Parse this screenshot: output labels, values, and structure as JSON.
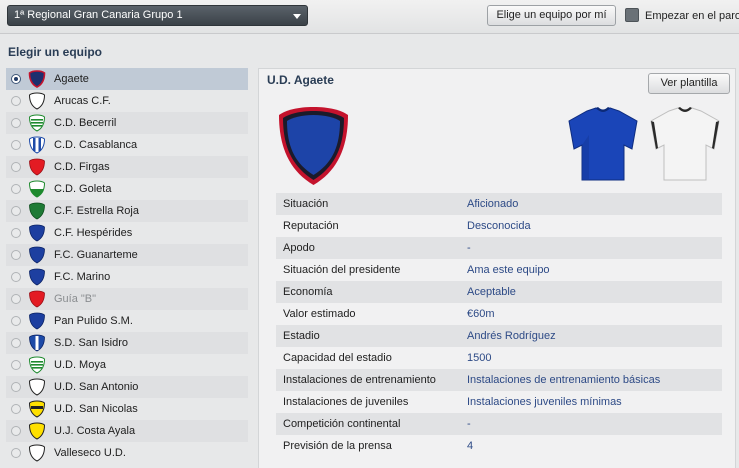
{
  "topbar": {
    "league_select": "1ª Regional Gran Canaria Grupo 1",
    "pick_button": "Elige un equipo por mí",
    "unemployed_label": "Empezar en el paro"
  },
  "left": {
    "title": "Elegir un equipo",
    "teams": [
      {
        "name": "Agaete",
        "crest": "shield-blue-red"
      },
      {
        "name": "Arucas C.F.",
        "crest": "shield-white"
      },
      {
        "name": "C.D. Becerril",
        "crest": "shield-green-stripes"
      },
      {
        "name": "C.D. Casablanca",
        "crest": "shield-blue-white-stripes"
      },
      {
        "name": "C.D. Firgas",
        "crest": "shield-red"
      },
      {
        "name": "C.D. Goleta",
        "crest": "shield-green-white"
      },
      {
        "name": "C.F. Estrella Roja",
        "crest": "shield-green"
      },
      {
        "name": "C.F. Hespérides",
        "crest": "shield-blue"
      },
      {
        "name": "F.C. Guanarteme",
        "crest": "shield-blue"
      },
      {
        "name": "F.C. Marino",
        "crest": "shield-blue"
      },
      {
        "name": "Guía \"B\"",
        "crest": "shield-red"
      },
      {
        "name": "Pan Pulido S.M.",
        "crest": "shield-blue"
      },
      {
        "name": "S.D. San Isidro",
        "crest": "shield-blue-white"
      },
      {
        "name": "U.D. Moya",
        "crest": "shield-green-stripes"
      },
      {
        "name": "U.D. San Antonio",
        "crest": "shield-white"
      },
      {
        "name": "U.D. San Nicolas",
        "crest": "shield-yellow-black"
      },
      {
        "name": "U.J. Costa Ayala",
        "crest": "shield-yellow"
      },
      {
        "name": "Valleseco U.D.",
        "crest": "shield-white"
      }
    ]
  },
  "right": {
    "club_name": "U.D. Agaete",
    "squad_button": "Ver plantilla",
    "details": [
      {
        "label": "Situación",
        "value": "Aficionado"
      },
      {
        "label": "Reputación",
        "value": "Desconocida"
      },
      {
        "label": "Apodo",
        "value": "-"
      },
      {
        "label": "Situación del presidente",
        "value": "Ama este equipo"
      },
      {
        "label": "Economía",
        "value": "Aceptable"
      },
      {
        "label": "Valor estimado",
        "value": "€60m"
      },
      {
        "label": "Estadio",
        "value": "Andrés Rodríguez"
      },
      {
        "label": "Capacidad del estadio",
        "value": "1500"
      },
      {
        "label": "Instalaciones de entrenamiento",
        "value": "Instalaciones de entrenamiento básicas"
      },
      {
        "label": "Instalaciones de juveniles",
        "value": "Instalaciones juveniles mínimas"
      },
      {
        "label": "Competición continental",
        "value": "-"
      },
      {
        "label": "Previsión de la prensa",
        "value": "4"
      }
    ]
  },
  "colors": {
    "accent_dark": "#2a3d55",
    "value_blue": "#2d4a86",
    "selected_row": "#c0cad6",
    "home_kit": "#1a45b8",
    "away_kit": "#f4f4f4",
    "crest_blue": "#1d2f6e",
    "crest_red": "#c4132d"
  }
}
